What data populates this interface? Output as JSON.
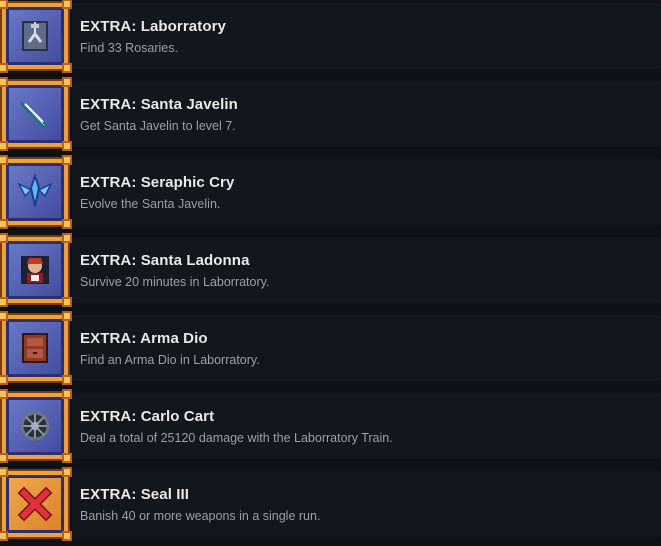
{
  "achievements": [
    {
      "title": "EXTRA: Laborratory",
      "description": "Find 33 Rosaries.",
      "icon": "claw-machine-icon"
    },
    {
      "title": "EXTRA: Santa Javelin",
      "description": "Get Santa Javelin to level 7.",
      "icon": "javelin-icon"
    },
    {
      "title": "EXTRA: Seraphic Cry",
      "description": "Evolve the Santa Javelin.",
      "icon": "winged-crystal-icon"
    },
    {
      "title": "EXTRA: Santa Ladonna",
      "description": "Survive 20 minutes in Laborratory.",
      "icon": "character-portrait-icon"
    },
    {
      "title": "EXTRA: Arma Dio",
      "description": "Find an Arma Dio in Laborratory.",
      "icon": "cabinet-icon"
    },
    {
      "title": "EXTRA: Carlo Cart",
      "description": "Deal a total of 25120 damage with the Laborratory Train.",
      "icon": "cart-wheel-icon"
    },
    {
      "title": "EXTRA: Seal III",
      "description": "Banish 40 or more weapons in a single run.",
      "icon": "red-x-icon"
    }
  ],
  "colors": {
    "background": "#0e1116",
    "row": "#12161d",
    "frame": "#f0a23a",
    "title": "#e9e9e9",
    "description": "#9aa0a8"
  }
}
